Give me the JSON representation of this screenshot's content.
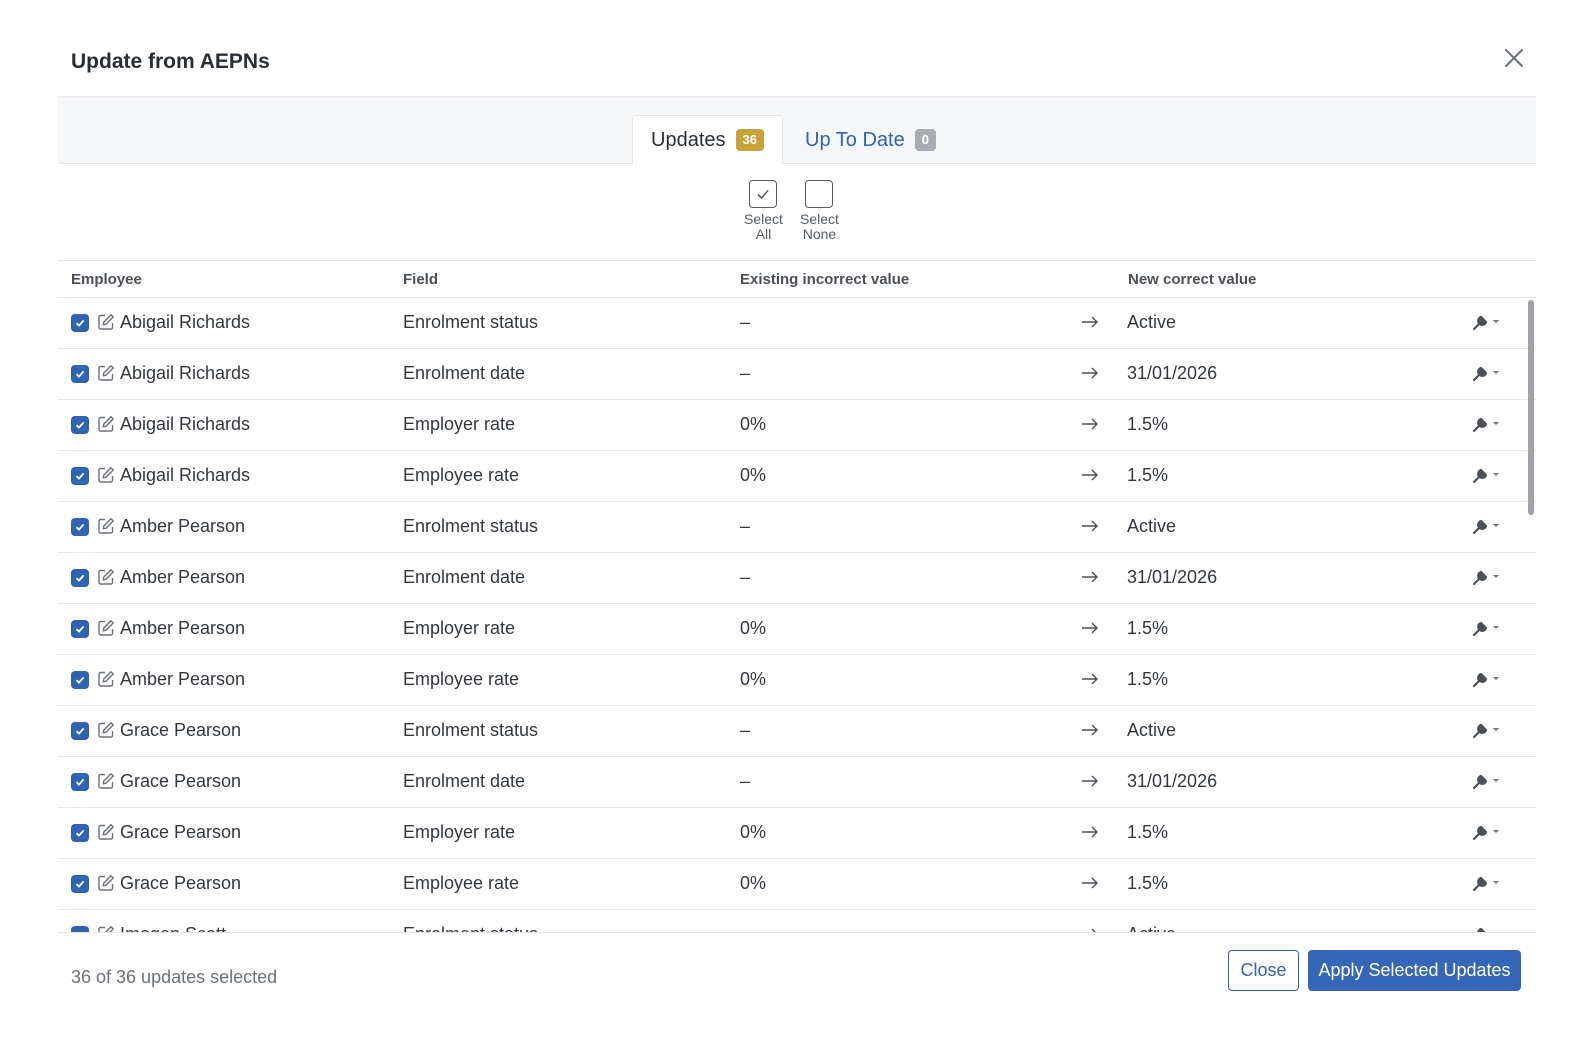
{
  "dialog": {
    "title": "Update from AEPNs"
  },
  "tabs": [
    {
      "label": "Updates",
      "count": "36",
      "active": true
    },
    {
      "label": "Up To Date",
      "count": "0",
      "active": false
    }
  ],
  "selection": {
    "select_all_line1": "Select",
    "select_all_line2": "All",
    "select_none_line1": "Select",
    "select_none_line2": "None"
  },
  "table": {
    "headers": {
      "employee": "Employee",
      "field": "Field",
      "existing": "Existing incorrect value",
      "new": "New correct value"
    },
    "rows": [
      {
        "employee": "Abigail Richards",
        "field": "Enrolment status",
        "existing": "–",
        "new": "Active",
        "checked": true
      },
      {
        "employee": "Abigail Richards",
        "field": "Enrolment date",
        "existing": "–",
        "new": "31/01/2026",
        "checked": true
      },
      {
        "employee": "Abigail Richards",
        "field": "Employer rate",
        "existing": "0%",
        "new": "1.5%",
        "checked": true
      },
      {
        "employee": "Abigail Richards",
        "field": "Employee rate",
        "existing": "0%",
        "new": "1.5%",
        "checked": true
      },
      {
        "employee": "Amber Pearson",
        "field": "Enrolment status",
        "existing": "–",
        "new": "Active",
        "checked": true
      },
      {
        "employee": "Amber Pearson",
        "field": "Enrolment date",
        "existing": "–",
        "new": "31/01/2026",
        "checked": true
      },
      {
        "employee": "Amber Pearson",
        "field": "Employer rate",
        "existing": "0%",
        "new": "1.5%",
        "checked": true
      },
      {
        "employee": "Amber Pearson",
        "field": "Employee rate",
        "existing": "0%",
        "new": "1.5%",
        "checked": true
      },
      {
        "employee": "Grace Pearson",
        "field": "Enrolment status",
        "existing": "–",
        "new": "Active",
        "checked": true
      },
      {
        "employee": "Grace Pearson",
        "field": "Enrolment date",
        "existing": "–",
        "new": "31/01/2026",
        "checked": true
      },
      {
        "employee": "Grace Pearson",
        "field": "Employer rate",
        "existing": "0%",
        "new": "1.5%",
        "checked": true
      },
      {
        "employee": "Grace Pearson",
        "field": "Employee rate",
        "existing": "0%",
        "new": "1.5%",
        "checked": true
      },
      {
        "employee": "Imogen Scott",
        "field": "Enrolment status",
        "existing": "–",
        "new": "Active",
        "checked": true
      }
    ]
  },
  "footer": {
    "selected_count": "36 of 36 updates selected",
    "close_label": "Close",
    "apply_label": "Apply Selected Updates"
  },
  "icons": {
    "close": "close-icon",
    "edit": "edit-icon",
    "arrow": "arrow-right-icon",
    "wrench": "wrench-icon",
    "check": "check-icon"
  },
  "colors": {
    "accent": "#2f63b4",
    "badge_active": "#c9a23a",
    "badge_inactive": "#a9adb3"
  }
}
